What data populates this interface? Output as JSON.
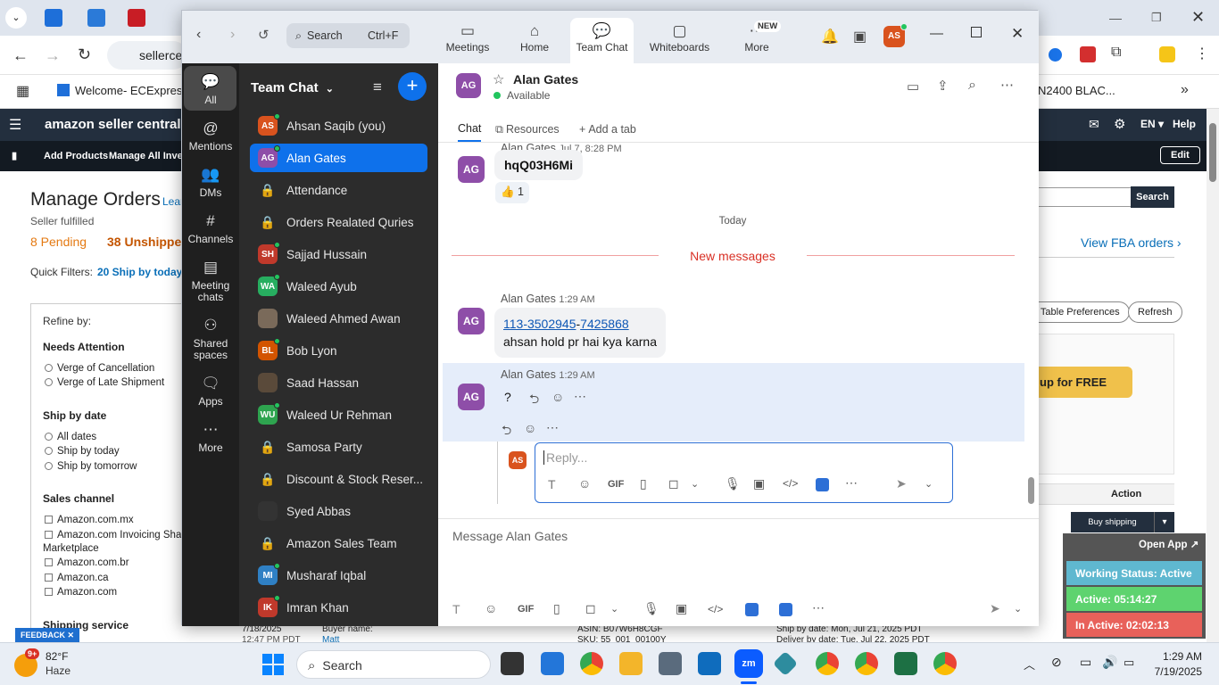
{
  "browser": {
    "address": "sellerce",
    "bookmark_welcome": "Welcome- ECExpres...",
    "bookmark_right": "N2400 BLAC..."
  },
  "amazon": {
    "logo": "amazon seller central",
    "lang": "EN",
    "help": "Help",
    "add_products": "Add Products",
    "manage_inventory": "Manage All Invent",
    "edit": "Edit",
    "page_title": "Manage Orders",
    "learn": "Lear",
    "seller_fulfilled": "Seller fulfilled",
    "pending": "8 Pending",
    "unshipped": "38 Unshipped",
    "quick_filters": "Quick Filters:",
    "ship_today_filter": "20 Ship by today",
    "refine": "Refine by:",
    "needs_attention": "Needs Attention",
    "cancel": "Verge of Cancellation",
    "late": "Verge of Late Shipment",
    "ship_by_date": "Ship by date",
    "all_dates": "All dates",
    "ship_today": "Ship by today",
    "ship_tomorrow": "Ship by tomorrow",
    "sales_channel": "Sales channel",
    "channels": [
      "Amazon.com.mx",
      "Amazon.com Invoicing Shado",
      "Marketplace",
      "Amazon.com.br",
      "Amazon.ca",
      "Amazon.com"
    ],
    "shipping_service": "Shipping service",
    "search_btn": "Search",
    "fba_link": "View FBA orders ›",
    "table_pref": "t Table Preferences",
    "refresh": "Refresh",
    "signup": "up for FREE",
    "action": "Action",
    "buy_shipping": "Buy shipping",
    "feedback": "FEEDBACK",
    "row_date": "7/18/2025",
    "row_time": "12:47 PM PDT",
    "buyer_name": "Buyer name:",
    "buyer": "Matt",
    "asin": "ASIN: B07W6H8CGF",
    "sku": "SKU: 55_001_00100Y",
    "ship_by": "Ship by date: Mon, Jul 21, 2025 PDT",
    "deliver_by": "Deliver by date: Tue, Jul 22, 2025 PDT"
  },
  "zoom": {
    "search_label": "Search",
    "search_shortcut": "Ctrl+F",
    "tabs": [
      {
        "label": "Meetings",
        "icon": "video-camera-icon"
      },
      {
        "label": "Home",
        "icon": "home-icon"
      },
      {
        "label": "Team Chat",
        "icon": "chat-icon"
      },
      {
        "label": "Whiteboards",
        "icon": "whiteboard-icon"
      },
      {
        "label": "More",
        "icon": "more-icon"
      }
    ],
    "new_badge": "NEW",
    "user_initials": "AS",
    "rail": [
      {
        "label": "All",
        "icon": "chat-bubble-icon"
      },
      {
        "label": "Mentions",
        "icon": "at-icon"
      },
      {
        "label": "DMs",
        "icon": "people-icon"
      },
      {
        "label": "Channels",
        "icon": "hash-icon"
      },
      {
        "label": "Meeting chats",
        "icon": "calendar-icon"
      },
      {
        "label": "Shared spaces",
        "icon": "shared-icon"
      },
      {
        "label": "Apps",
        "icon": "apps-icon"
      },
      {
        "label": "More",
        "icon": "ellipsis-icon"
      }
    ],
    "list_title": "Team Chat",
    "channels": [
      {
        "name": "Ahsan Saqib (you)",
        "initials": "AS",
        "color": "#d9531e",
        "lock": false
      },
      {
        "name": "Alan Gates",
        "initials": "AG",
        "color": "#8e4ea8",
        "lock": false
      },
      {
        "name": "Attendance",
        "initials": "",
        "color": "",
        "lock": true
      },
      {
        "name": "Orders Realated Quries",
        "initials": "",
        "color": "",
        "lock": true
      },
      {
        "name": "Sajjad Hussain",
        "initials": "SH",
        "color": "#c0392b",
        "lock": false
      },
      {
        "name": "Waleed Ayub",
        "initials": "WA",
        "color": "#27ae60",
        "lock": false
      },
      {
        "name": "Waleed Ahmed Awan",
        "initials": "",
        "color": "#7a6a5a",
        "lock": false
      },
      {
        "name": "Bob Lyon",
        "initials": "BL",
        "color": "#d35400",
        "lock": false
      },
      {
        "name": "Saad Hassan",
        "initials": "",
        "color": "#5a4a3a",
        "lock": false
      },
      {
        "name": "Waleed Ur Rehman",
        "initials": "WU",
        "color": "#2ea44f",
        "lock": false
      },
      {
        "name": "Samosa Party",
        "initials": "",
        "color": "",
        "lock": true
      },
      {
        "name": "Discount & Stock Reser...",
        "initials": "",
        "color": "",
        "lock": true
      },
      {
        "name": "Syed Abbas",
        "initials": "",
        "color": "#333333",
        "lock": false
      },
      {
        "name": "Amazon Sales Team",
        "initials": "",
        "color": "",
        "lock": true
      },
      {
        "name": "Musharaf Iqbal",
        "initials": "MI",
        "color": "#2f80c4",
        "lock": false
      },
      {
        "name": "Imran Khan",
        "initials": "IK",
        "color": "#c0392b",
        "lock": false
      }
    ],
    "chat": {
      "name": "Alan Gates",
      "initials": "AG",
      "status": "Available",
      "tab_chat": "Chat",
      "tab_resources": "Resources",
      "tab_add": "Add a tab",
      "msg1_sender": "Alan Gates",
      "msg1_time": "Jul 7, 8:28 PM",
      "msg1_text": "hqQ03H6Mi",
      "reaction": "👍 1",
      "today": "Today",
      "new_messages": "New messages",
      "msg2_sender": "Alan Gates",
      "msg2_time": "1:29 AM",
      "msg2_link_a": "113-3502945",
      "msg2_dash": "-",
      "msg2_link_b": "7425868",
      "msg2_text": "ahsan hold pr hai kya karna",
      "msg3_sender": "Alan Gates",
      "msg3_time": "1:29 AM",
      "msg3_text": "?",
      "reply_placeholder": "Reply...",
      "reply_initials": "AS",
      "gif": "GIF",
      "compose_placeholder": "Message Alan Gates"
    }
  },
  "widget": {
    "open_app": "Open App ↗",
    "working": "Working Status: Active",
    "active": "Active: 05:14:27",
    "inactive": "In Active: 02:02:13"
  },
  "taskbar": {
    "weather_badge": "9+",
    "temp": "82°F",
    "condition": "Haze",
    "search": "Search",
    "time": "1:29 AM",
    "date": "7/19/2025"
  }
}
